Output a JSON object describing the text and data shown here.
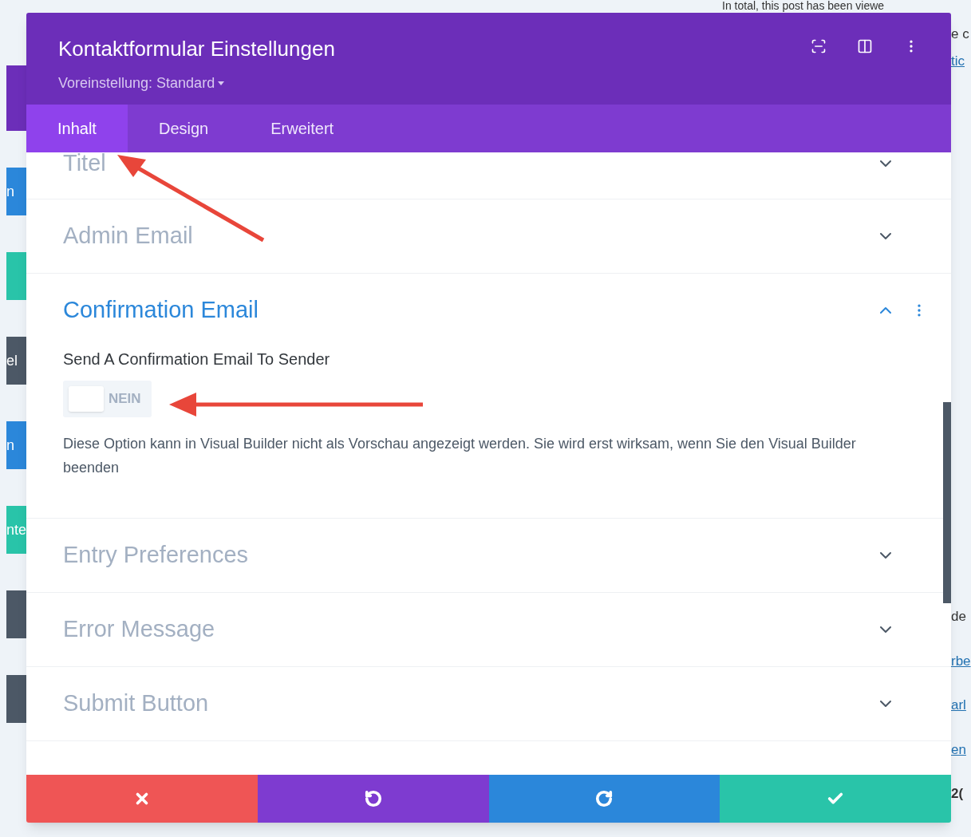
{
  "background": {
    "top_text": "In total, this post has been viewe",
    "right_fragments": [
      {
        "text": "e c",
        "kind": "plain"
      },
      {
        "text": "tic",
        "kind": "link"
      },
      {
        "text": "de",
        "kind": "plain"
      },
      {
        "text": "rbe",
        "kind": "link"
      },
      {
        "text": "arl",
        "kind": "link"
      },
      {
        "text": "en",
        "kind": "link"
      },
      {
        "text": "2(",
        "kind": "bold"
      }
    ],
    "left_tags": [
      {
        "text": "n",
        "color": "#2b87da"
      },
      {
        "color": "#29c4a9"
      },
      {
        "text": "el",
        "color": "#4c5866"
      },
      {
        "text": "n",
        "color": "#2b87da"
      },
      {
        "text": "nte",
        "color": "#29c4a9"
      },
      {
        "color": "#4c5866"
      },
      {
        "color": "#4c5866"
      }
    ]
  },
  "modal": {
    "title": "Kontaktformular Einstellungen",
    "preset": "Voreinstellung: Standard",
    "tabs": [
      {
        "label": "Inhalt",
        "selected": true
      },
      {
        "label": "Design",
        "selected": false
      },
      {
        "label": "Erweitert",
        "selected": false
      }
    ],
    "sections": [
      {
        "title": "Titel",
        "expanded": false
      },
      {
        "title": "Admin Email",
        "expanded": false
      },
      {
        "title": "Confirmation Email",
        "expanded": true,
        "field_label": "Send A Confirmation Email To Sender",
        "toggle": {
          "on": false,
          "label": "NEIN"
        },
        "description": "Diese Option kann in Visual Builder nicht als Vorschau angezeigt werden. Sie wird erst wirksam, wenn Sie den Visual Builder beenden"
      },
      {
        "title": "Entry Preferences",
        "expanded": false
      },
      {
        "title": "Error Message",
        "expanded": false
      },
      {
        "title": "Submit Button",
        "expanded": false
      }
    ],
    "footer": [
      {
        "kind": "cancel"
      },
      {
        "kind": "undo"
      },
      {
        "kind": "redo"
      },
      {
        "kind": "save"
      }
    ]
  }
}
